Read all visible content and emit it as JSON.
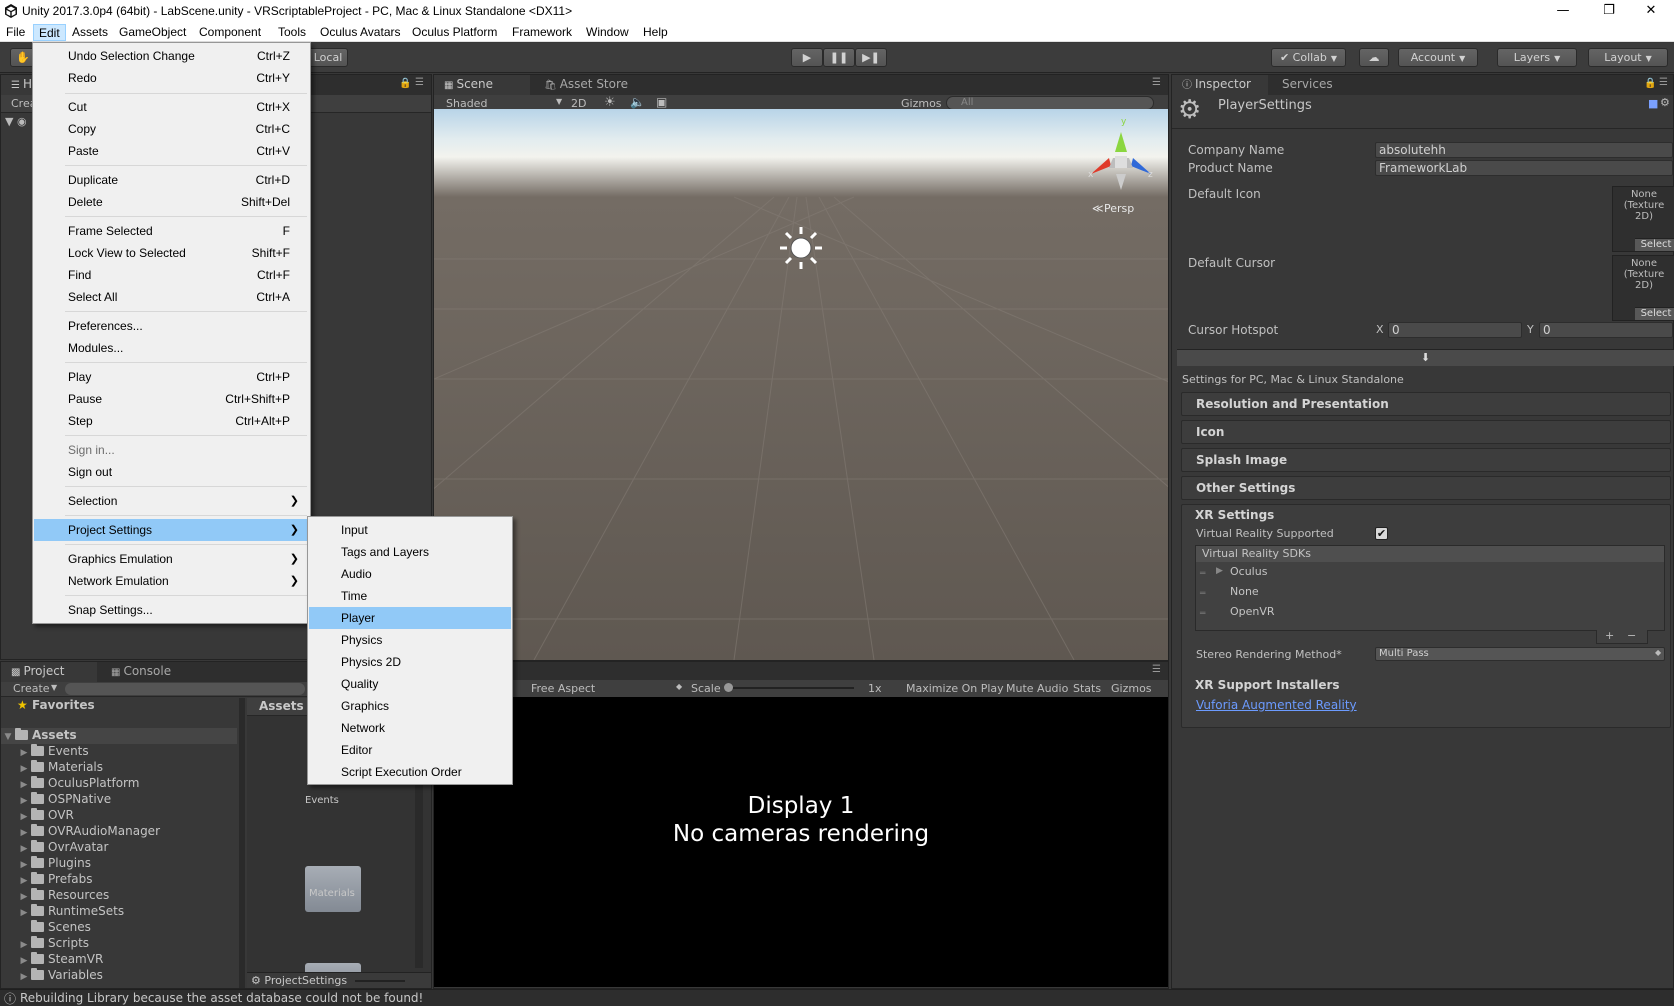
{
  "window": {
    "title": "Unity 2017.3.0p4 (64bit) - LabScene.unity - VRScriptableProject - PC, Mac & Linux Standalone <DX11>"
  },
  "menubar": [
    "File",
    "Edit",
    "Assets",
    "GameObject",
    "Component",
    "Tools",
    "Oculus Avatars",
    "Oculus Platform",
    "Framework",
    "Window",
    "Help"
  ],
  "toolbar": {
    "pivot_mode": "Local",
    "collab": "Collab",
    "account": "Account",
    "layers": "Layers",
    "layout": "Layout"
  },
  "hierarchy": {
    "tab": "H",
    "create": "Crea"
  },
  "scene": {
    "tab": "Scene",
    "asset_store_tab": "Asset Store",
    "shading": "Shaded",
    "mode_2d": "2D",
    "gizmos": "Gizmos",
    "search_placeholder": "All",
    "persp": "Persp",
    "axis_y": "y",
    "axis_x": "x",
    "axis_z": "z"
  },
  "game": {
    "aspect": "Free Aspect",
    "scale_label": "Scale",
    "scale_value": "1x",
    "maximize": "Maximize On Play",
    "mute": "Mute Audio",
    "stats": "Stats",
    "gizmos": "Gizmos",
    "display": "Display 1",
    "message": "No cameras rendering"
  },
  "project": {
    "tab": "Project",
    "console_tab": "Console",
    "create": "Create",
    "favorites": "Favorites",
    "assets_root": "Assets",
    "folders": [
      "Events",
      "Materials",
      "OculusPlatform",
      "OSPNative",
      "OVR",
      "OVRAudioManager",
      "OvrAvatar",
      "Plugins",
      "Prefabs",
      "Resources",
      "RuntimeSets",
      "Scenes",
      "Scripts",
      "SteamVR",
      "Variables"
    ],
    "grid_header": "Assets",
    "grid_items": [
      "Events",
      "Materials"
    ],
    "footer_path": "ProjectSettings"
  },
  "inspector": {
    "tab": "Inspector",
    "services_tab": "Services",
    "object_name": "PlayerSettings",
    "company_label": "Company Name",
    "company_value": "absolutehh",
    "product_label": "Product Name",
    "product_value": "FrameworkLab",
    "default_icon_label": "Default Icon",
    "default_cursor_label": "Default Cursor",
    "tex_none": "None",
    "tex_type": "(Texture",
    "tex_type2": "2D)",
    "select": "Select",
    "hotspot_label": "Cursor Hotspot",
    "hotspot_x_label": "X",
    "hotspot_x": "0",
    "hotspot_y_label": "Y",
    "hotspot_y": "0",
    "settings_for": "Settings for PC, Mac & Linux Standalone",
    "sections": [
      "Resolution and Presentation",
      "Icon",
      "Splash Image",
      "Other Settings"
    ],
    "xr_header": "XR Settings",
    "vr_supported_label": "Virtual Reality Supported",
    "vr_supported": true,
    "vr_sdks_header": "Virtual Reality SDKs",
    "vr_sdks": [
      "Oculus",
      "None",
      "OpenVR"
    ],
    "stereo_label": "Stereo Rendering Method*",
    "stereo_value": "Multi Pass",
    "xr_installers": "XR Support Installers",
    "vuforia_link": "Vuforia Augmented Reality"
  },
  "edit_menu": {
    "items": [
      {
        "label": "Undo Selection Change",
        "shortcut": "Ctrl+Z"
      },
      {
        "label": "Redo",
        "shortcut": "Ctrl+Y"
      },
      {
        "label": "Cut",
        "shortcut": "Ctrl+X"
      },
      {
        "label": "Copy",
        "shortcut": "Ctrl+C"
      },
      {
        "label": "Paste",
        "shortcut": "Ctrl+V"
      },
      {
        "label": "Duplicate",
        "shortcut": "Ctrl+D"
      },
      {
        "label": "Delete",
        "shortcut": "Shift+Del"
      },
      {
        "label": "Frame Selected",
        "shortcut": "F"
      },
      {
        "label": "Lock View to Selected",
        "shortcut": "Shift+F"
      },
      {
        "label": "Find",
        "shortcut": "Ctrl+F"
      },
      {
        "label": "Select All",
        "shortcut": "Ctrl+A"
      },
      {
        "label": "Preferences...",
        "shortcut": ""
      },
      {
        "label": "Modules...",
        "shortcut": ""
      },
      {
        "label": "Play",
        "shortcut": "Ctrl+P"
      },
      {
        "label": "Pause",
        "shortcut": "Ctrl+Shift+P"
      },
      {
        "label": "Step",
        "shortcut": "Ctrl+Alt+P"
      },
      {
        "label": "Sign in...",
        "shortcut": ""
      },
      {
        "label": "Sign out",
        "shortcut": ""
      },
      {
        "label": "Selection",
        "shortcut": ""
      },
      {
        "label": "Project Settings",
        "shortcut": ""
      },
      {
        "label": "Graphics Emulation",
        "shortcut": ""
      },
      {
        "label": "Network Emulation",
        "shortcut": ""
      },
      {
        "label": "Snap Settings...",
        "shortcut": ""
      }
    ]
  },
  "project_settings_menu": [
    "Input",
    "Tags and Layers",
    "Audio",
    "Time",
    "Player",
    "Physics",
    "Physics 2D",
    "Quality",
    "Graphics",
    "Network",
    "Editor",
    "Script Execution Order"
  ],
  "status": "Rebuilding Library because the asset database could not be found!",
  "colors": {
    "menu_highlight": "#91c9f7",
    "link": "#4c7fff",
    "panel_bg": "#383838"
  }
}
